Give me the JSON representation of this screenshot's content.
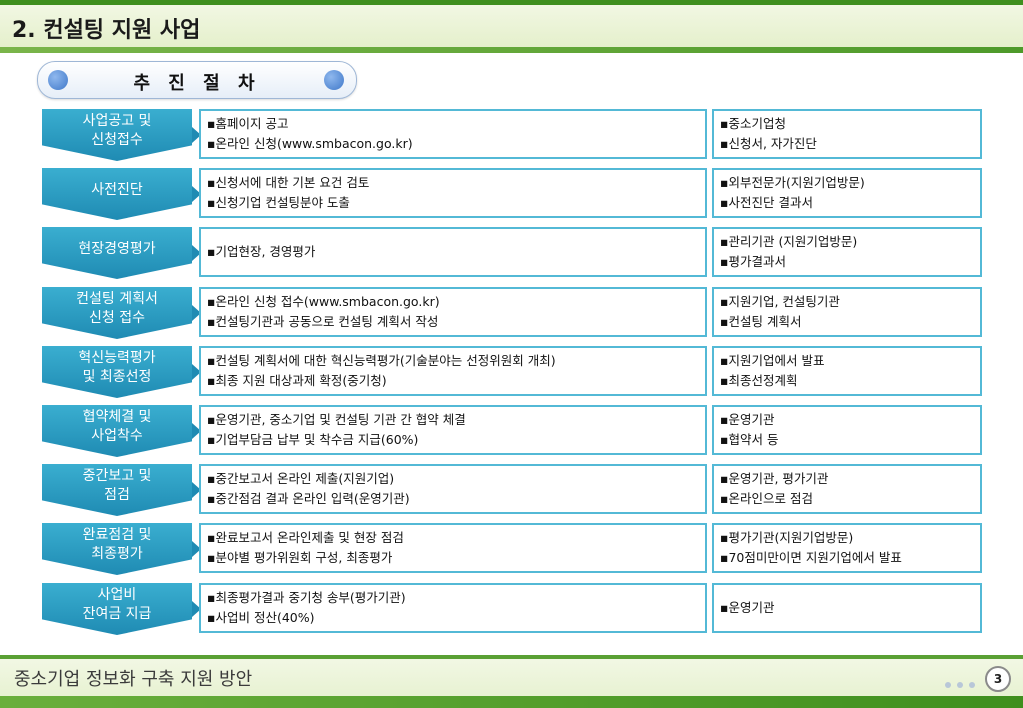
{
  "title": "2. 컨설팅 지원 사업",
  "process_title": "추 진 절 차",
  "rows": [
    {
      "step": [
        "사업공고 및",
        "신청접수"
      ],
      "actions": [
        "▪홈페이지 공고",
        "▪온라인 신청(www.smbacon.go.kr)"
      ],
      "owners": [
        "▪중소기업청",
        "▪신청서, 자가진단"
      ]
    },
    {
      "step": [
        "사전진단",
        ""
      ],
      "actions": [
        "▪신청서에 대한 기본 요건 검토",
        "▪신청기업 컨설팅분야 도출"
      ],
      "owners": [
        "▪외부전문가(지원기업방문)",
        "▪사전진단 결과서"
      ]
    },
    {
      "step": [
        "현장경영평가",
        ""
      ],
      "actions": [
        "▪기업현장, 경영평가",
        ""
      ],
      "owners": [
        "▪관리기관 (지원기업방문)",
        "▪평가결과서"
      ]
    },
    {
      "step": [
        "컨설팅 계획서",
        "신청 접수"
      ],
      "actions": [
        "▪온라인 신청 접수(www.smbacon.go.kr)",
        "▪컨설팅기관과 공동으로 컨설팅 계획서 작성"
      ],
      "owners": [
        "▪지원기업, 컨설팅기관",
        "▪컨설팅 계획서"
      ]
    },
    {
      "step": [
        "혁신능력평가",
        "및 최종선정"
      ],
      "actions": [
        "▪컨설팅 계획서에 대한 혁신능력평가(기술분야는 선정위원회 개최)",
        "▪최종 지원 대상과제 확정(중기청)"
      ],
      "owners": [
        "▪지원기업에서 발표",
        "▪최종선정계획"
      ]
    },
    {
      "step": [
        "협약체결 및",
        "사업착수"
      ],
      "actions": [
        "▪운영기관, 중소기업 및 컨설팅 기관 간 협약 체결",
        "▪기업부담금 납부 및 착수금 지급(60%)"
      ],
      "owners": [
        "▪운영기관",
        "▪협약서 등"
      ]
    },
    {
      "step": [
        "중간보고 및",
        "점검"
      ],
      "actions": [
        "▪중간보고서 온라인 제출(지원기업)",
        "▪중간점검 결과 온라인 입력(운영기관)"
      ],
      "owners": [
        "▪운영기관, 평가기관",
        "▪온라인으로 점검"
      ]
    },
    {
      "step": [
        "완료점검 및",
        "최종평가"
      ],
      "actions": [
        "▪완료보고서 온라인제출 및 현장 점검",
        "▪분야별 평가위원회 구성, 최종평가"
      ],
      "owners": [
        "▪평가기관(지원기업방문)",
        "▪70점미만이면 지원기업에서 발표"
      ]
    },
    {
      "step": [
        "사업비",
        "잔여금 지급"
      ],
      "actions": [
        "▪최종평가결과 중기청 송부(평가기관)",
        "▪사업비 정산(40%)"
      ],
      "owners": [
        "▪운영기관",
        ""
      ]
    }
  ],
  "footer": {
    "title": "중소기업 정보화 구축 지원 방안",
    "page": "3"
  },
  "colors": {
    "accent_green": "#3f8f1e",
    "step_blue": "#1f8bb3",
    "box_border": "#53b9d6"
  }
}
